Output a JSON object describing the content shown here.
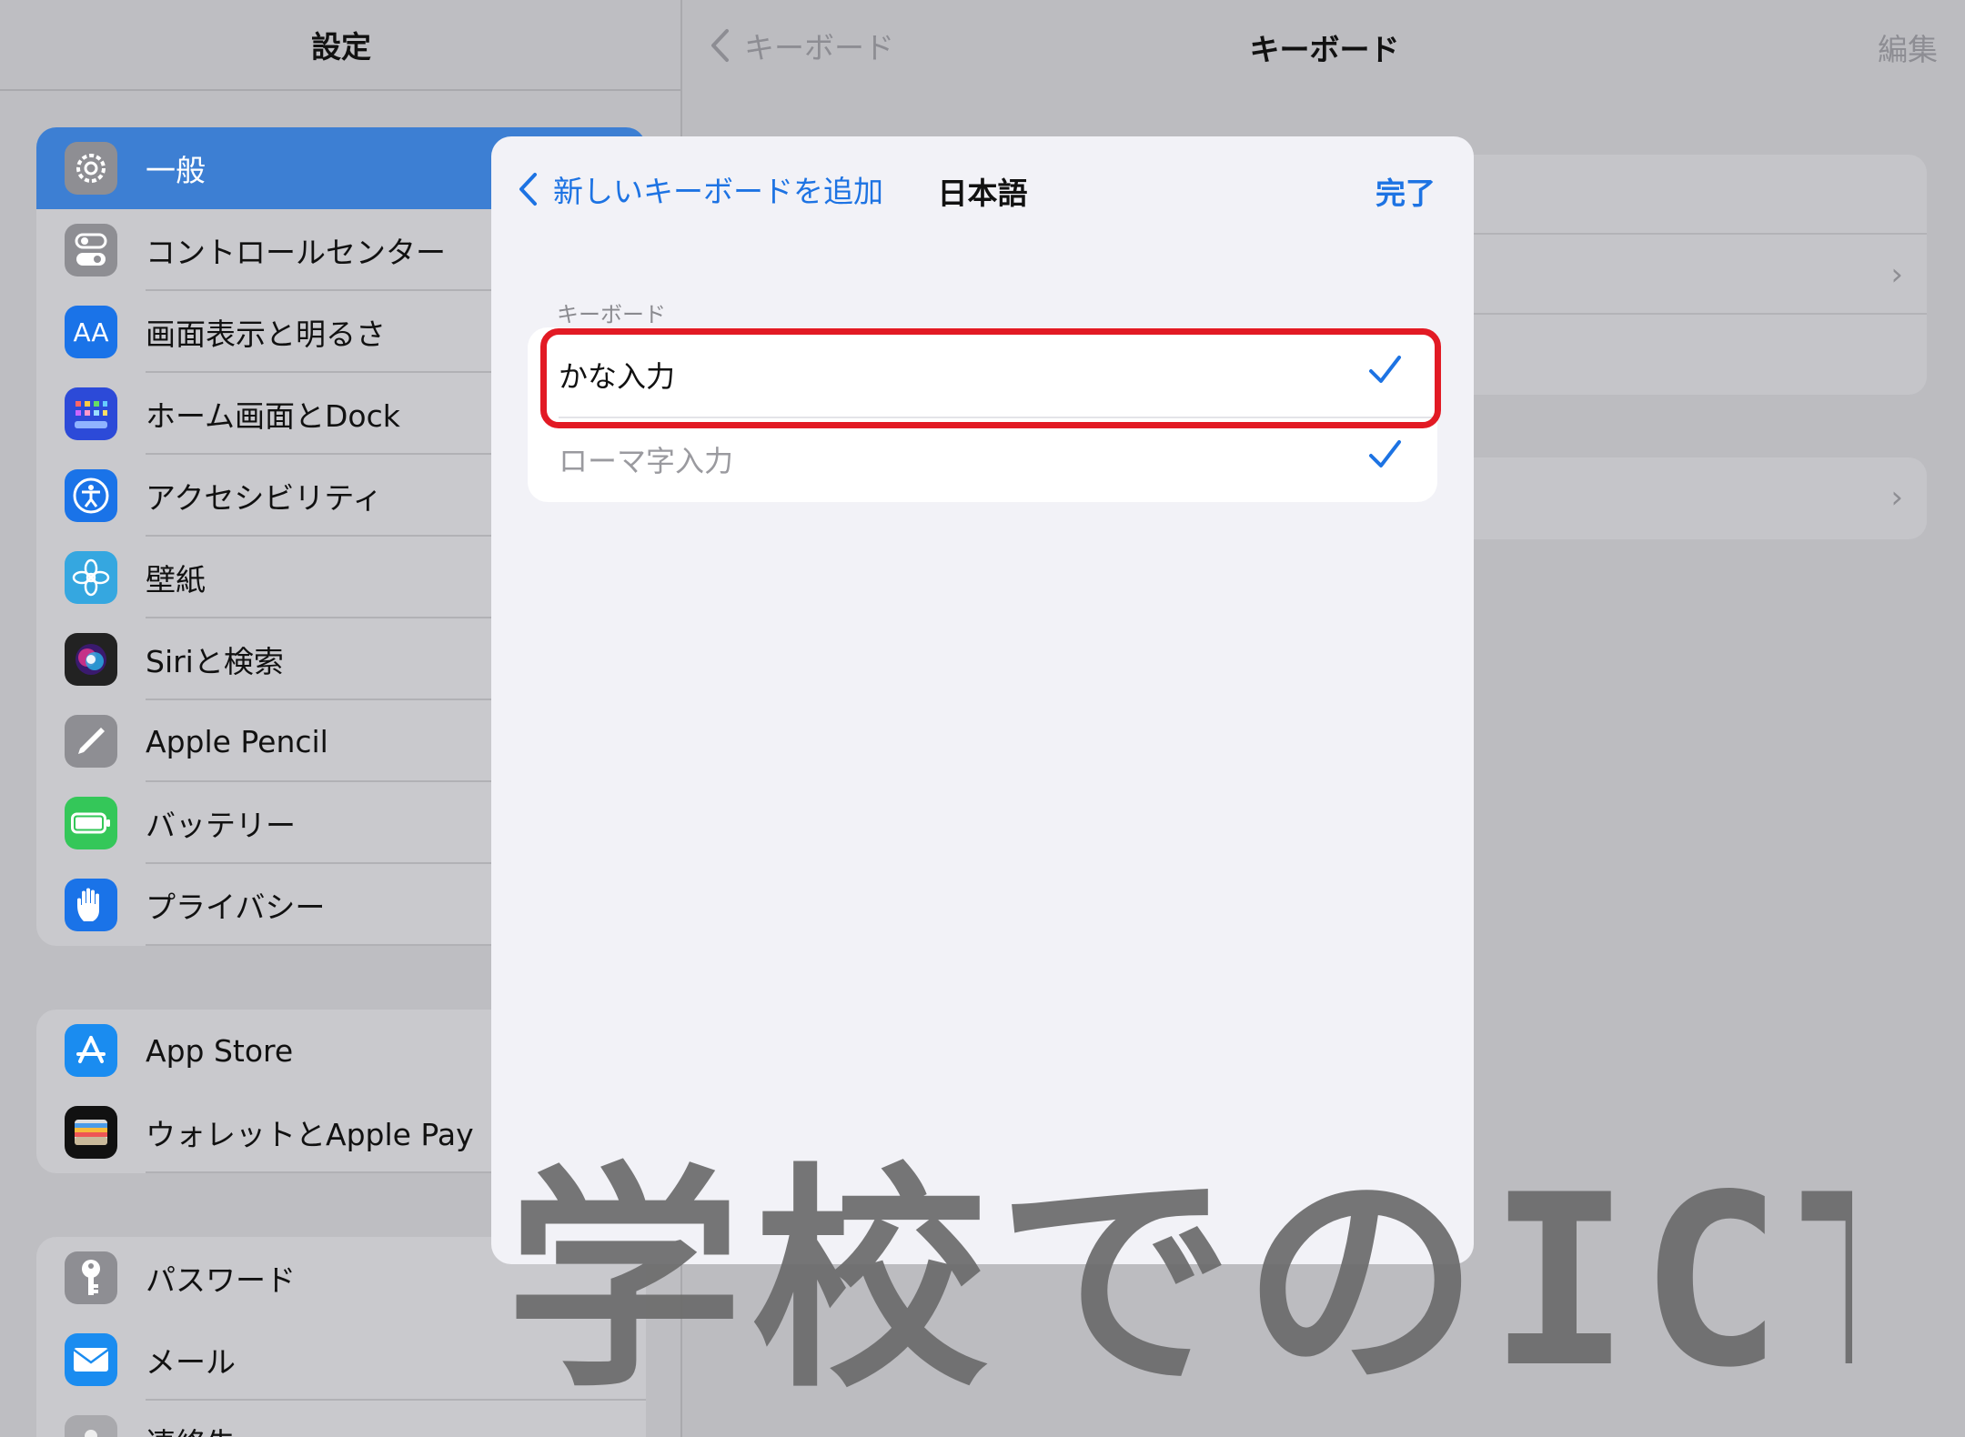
{
  "sidebar": {
    "title": "設定",
    "group1": [
      {
        "label": "一般",
        "icon": "gear-icon",
        "color": "#8e8e93",
        "selected": true
      },
      {
        "label": "コントロールセンター",
        "icon": "toggles-icon",
        "color": "#8e8e93"
      },
      {
        "label": "画面表示と明るさ",
        "icon": "text-size-icon",
        "color": "#1a73e8"
      },
      {
        "label": "ホーム画面とDock",
        "icon": "home-grid-icon",
        "color": "#2c4ad8"
      },
      {
        "label": "アクセシビリティ",
        "icon": "accessibility-icon",
        "color": "#1a73e8"
      },
      {
        "label": "壁紙",
        "icon": "flower-icon",
        "color": "#35a7e0"
      },
      {
        "label": "Siriと検索",
        "icon": "siri-icon",
        "color": "#222222"
      },
      {
        "label": "Apple Pencil",
        "icon": "pencil-icon",
        "color": "#8e8e93"
      },
      {
        "label": "バッテリー",
        "icon": "battery-icon",
        "color": "#34c759"
      },
      {
        "label": "プライバシー",
        "icon": "hand-icon",
        "color": "#1a73e8"
      }
    ],
    "group2": [
      {
        "label": "App Store",
        "icon": "app-store-icon",
        "color": "#1a8cf0"
      },
      {
        "label": "ウォレットとApple Pay",
        "icon": "wallet-icon",
        "color": "#111111"
      }
    ],
    "group3": [
      {
        "label": "パスワード",
        "icon": "key-icon",
        "color": "#8e8e93"
      },
      {
        "label": "メール",
        "icon": "mail-icon",
        "color": "#1a8cf0"
      },
      {
        "label": "連絡先",
        "icon": "contacts-icon",
        "color": "#a9a9ad"
      }
    ]
  },
  "detail": {
    "back_label": "キーボード",
    "title": "キーボード",
    "edit_label": "編集"
  },
  "sheet": {
    "back_label": "新しいキーボードを追加",
    "title": "日本語",
    "done_label": "完了",
    "section_header": "キーボード",
    "options": [
      {
        "label": "かな入力",
        "checked": true
      },
      {
        "label": "ローマ字入力",
        "checked": true
      }
    ]
  },
  "colors": {
    "accent": "#1d73e3",
    "highlight": "#e21a24"
  },
  "watermark": "学校でのICT"
}
